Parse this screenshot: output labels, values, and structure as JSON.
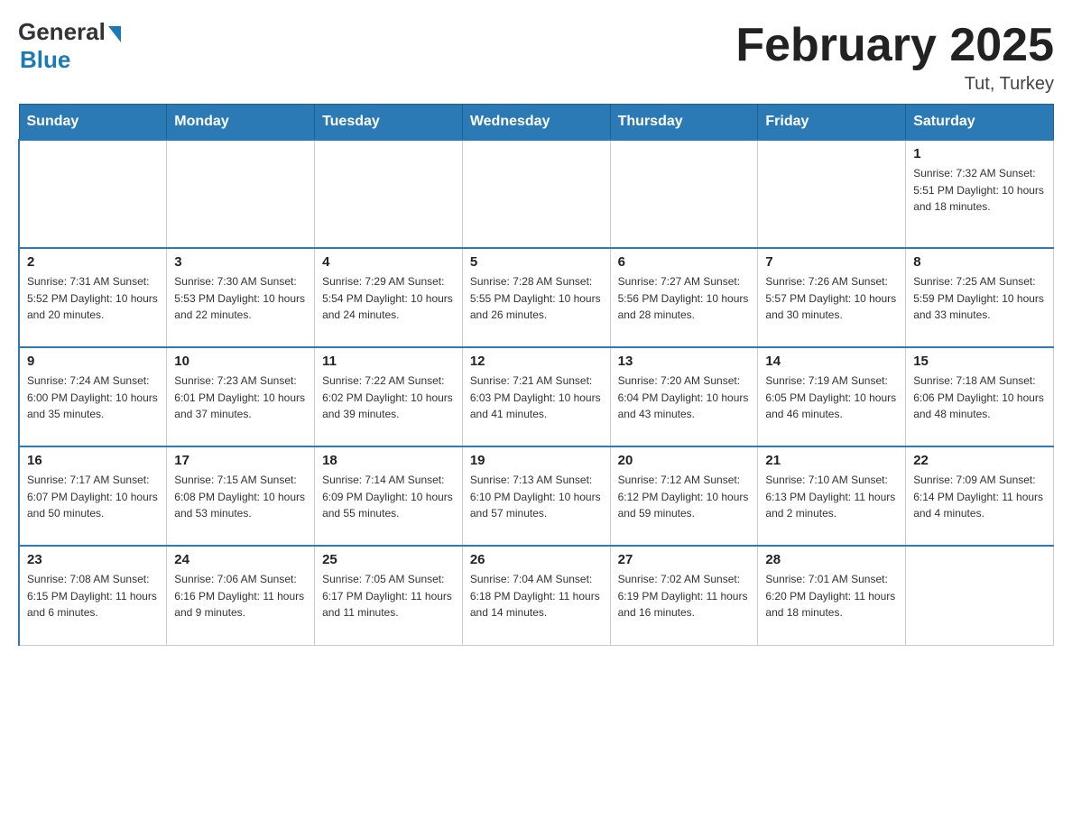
{
  "header": {
    "logo_general": "General",
    "logo_blue": "Blue",
    "month_title": "February 2025",
    "location": "Tut, Turkey"
  },
  "days_of_week": [
    "Sunday",
    "Monday",
    "Tuesday",
    "Wednesday",
    "Thursday",
    "Friday",
    "Saturday"
  ],
  "weeks": [
    [
      {
        "day": "",
        "info": ""
      },
      {
        "day": "",
        "info": ""
      },
      {
        "day": "",
        "info": ""
      },
      {
        "day": "",
        "info": ""
      },
      {
        "day": "",
        "info": ""
      },
      {
        "day": "",
        "info": ""
      },
      {
        "day": "1",
        "info": "Sunrise: 7:32 AM\nSunset: 5:51 PM\nDaylight: 10 hours\nand 18 minutes."
      }
    ],
    [
      {
        "day": "2",
        "info": "Sunrise: 7:31 AM\nSunset: 5:52 PM\nDaylight: 10 hours\nand 20 minutes."
      },
      {
        "day": "3",
        "info": "Sunrise: 7:30 AM\nSunset: 5:53 PM\nDaylight: 10 hours\nand 22 minutes."
      },
      {
        "day": "4",
        "info": "Sunrise: 7:29 AM\nSunset: 5:54 PM\nDaylight: 10 hours\nand 24 minutes."
      },
      {
        "day": "5",
        "info": "Sunrise: 7:28 AM\nSunset: 5:55 PM\nDaylight: 10 hours\nand 26 minutes."
      },
      {
        "day": "6",
        "info": "Sunrise: 7:27 AM\nSunset: 5:56 PM\nDaylight: 10 hours\nand 28 minutes."
      },
      {
        "day": "7",
        "info": "Sunrise: 7:26 AM\nSunset: 5:57 PM\nDaylight: 10 hours\nand 30 minutes."
      },
      {
        "day": "8",
        "info": "Sunrise: 7:25 AM\nSunset: 5:59 PM\nDaylight: 10 hours\nand 33 minutes."
      }
    ],
    [
      {
        "day": "9",
        "info": "Sunrise: 7:24 AM\nSunset: 6:00 PM\nDaylight: 10 hours\nand 35 minutes."
      },
      {
        "day": "10",
        "info": "Sunrise: 7:23 AM\nSunset: 6:01 PM\nDaylight: 10 hours\nand 37 minutes."
      },
      {
        "day": "11",
        "info": "Sunrise: 7:22 AM\nSunset: 6:02 PM\nDaylight: 10 hours\nand 39 minutes."
      },
      {
        "day": "12",
        "info": "Sunrise: 7:21 AM\nSunset: 6:03 PM\nDaylight: 10 hours\nand 41 minutes."
      },
      {
        "day": "13",
        "info": "Sunrise: 7:20 AM\nSunset: 6:04 PM\nDaylight: 10 hours\nand 43 minutes."
      },
      {
        "day": "14",
        "info": "Sunrise: 7:19 AM\nSunset: 6:05 PM\nDaylight: 10 hours\nand 46 minutes."
      },
      {
        "day": "15",
        "info": "Sunrise: 7:18 AM\nSunset: 6:06 PM\nDaylight: 10 hours\nand 48 minutes."
      }
    ],
    [
      {
        "day": "16",
        "info": "Sunrise: 7:17 AM\nSunset: 6:07 PM\nDaylight: 10 hours\nand 50 minutes."
      },
      {
        "day": "17",
        "info": "Sunrise: 7:15 AM\nSunset: 6:08 PM\nDaylight: 10 hours\nand 53 minutes."
      },
      {
        "day": "18",
        "info": "Sunrise: 7:14 AM\nSunset: 6:09 PM\nDaylight: 10 hours\nand 55 minutes."
      },
      {
        "day": "19",
        "info": "Sunrise: 7:13 AM\nSunset: 6:10 PM\nDaylight: 10 hours\nand 57 minutes."
      },
      {
        "day": "20",
        "info": "Sunrise: 7:12 AM\nSunset: 6:12 PM\nDaylight: 10 hours\nand 59 minutes."
      },
      {
        "day": "21",
        "info": "Sunrise: 7:10 AM\nSunset: 6:13 PM\nDaylight: 11 hours\nand 2 minutes."
      },
      {
        "day": "22",
        "info": "Sunrise: 7:09 AM\nSunset: 6:14 PM\nDaylight: 11 hours\nand 4 minutes."
      }
    ],
    [
      {
        "day": "23",
        "info": "Sunrise: 7:08 AM\nSunset: 6:15 PM\nDaylight: 11 hours\nand 6 minutes."
      },
      {
        "day": "24",
        "info": "Sunrise: 7:06 AM\nSunset: 6:16 PM\nDaylight: 11 hours\nand 9 minutes."
      },
      {
        "day": "25",
        "info": "Sunrise: 7:05 AM\nSunset: 6:17 PM\nDaylight: 11 hours\nand 11 minutes."
      },
      {
        "day": "26",
        "info": "Sunrise: 7:04 AM\nSunset: 6:18 PM\nDaylight: 11 hours\nand 14 minutes."
      },
      {
        "day": "27",
        "info": "Sunrise: 7:02 AM\nSunset: 6:19 PM\nDaylight: 11 hours\nand 16 minutes."
      },
      {
        "day": "28",
        "info": "Sunrise: 7:01 AM\nSunset: 6:20 PM\nDaylight: 11 hours\nand 18 minutes."
      },
      {
        "day": "",
        "info": ""
      }
    ]
  ]
}
